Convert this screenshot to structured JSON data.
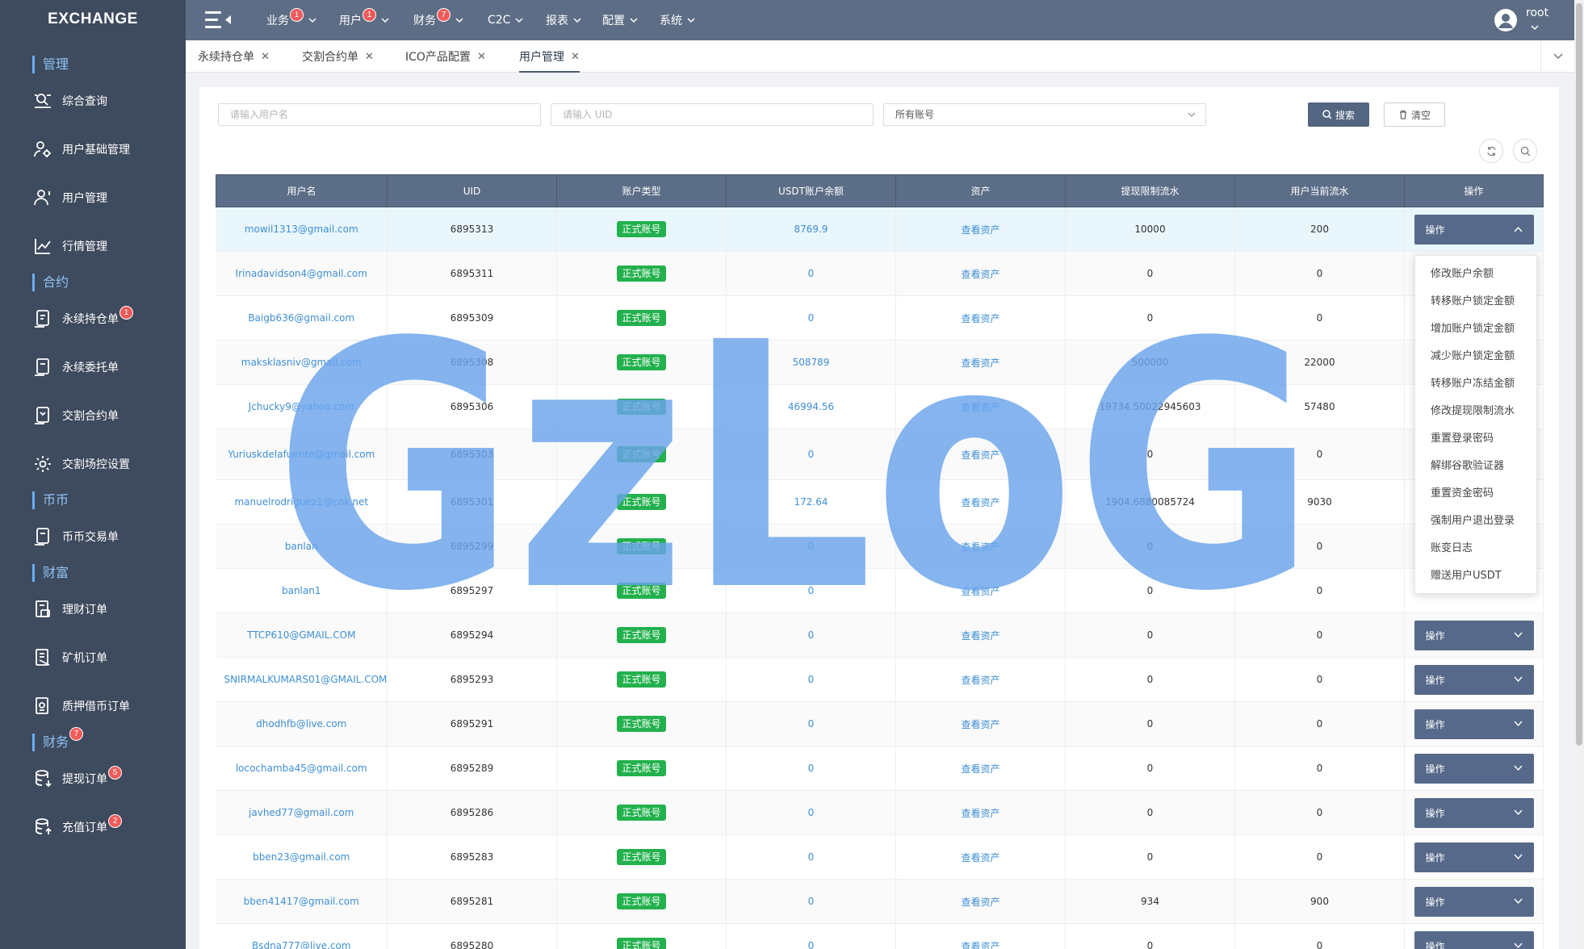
{
  "app": {
    "logo": "EXCHANGE"
  },
  "sidebar": {
    "sections": [
      {
        "label": "管理"
      },
      {
        "label": "合约"
      },
      {
        "label": "币币"
      },
      {
        "label": "财富"
      },
      {
        "label": "财务",
        "badge": "7"
      }
    ],
    "items": [
      {
        "label": "综合查询",
        "icon": "search-list-icon"
      },
      {
        "label": "用户基础管理",
        "icon": "user-gear-icon"
      },
      {
        "label": "用户管理",
        "icon": "user-icon"
      },
      {
        "label": "行情管理",
        "icon": "chart-line-icon"
      },
      {
        "label": "永续持仓单",
        "icon": "document-icon",
        "badge": "1"
      },
      {
        "label": "永续委托单",
        "icon": "document-icon"
      },
      {
        "label": "交割合约单",
        "icon": "document-icon"
      },
      {
        "label": "交割场控设置",
        "icon": "gear-icon"
      },
      {
        "label": "币币交易单",
        "icon": "document-icon"
      },
      {
        "label": "理财订单",
        "icon": "order-icon"
      },
      {
        "label": "矿机订单",
        "icon": "order-icon"
      },
      {
        "label": "质押借币订单",
        "icon": "order-icon"
      },
      {
        "label": "提现订单",
        "icon": "database-icon",
        "badge": "5"
      },
      {
        "label": "充值订单",
        "icon": "database-icon",
        "badge": "2"
      }
    ]
  },
  "topbar": {
    "nav": [
      {
        "label": "业务",
        "badge": "1"
      },
      {
        "label": "用户",
        "badge": "1"
      },
      {
        "label": "财务",
        "badge": "7"
      },
      {
        "label": "C2C"
      },
      {
        "label": "报表"
      },
      {
        "label": "配置"
      },
      {
        "label": "系统"
      }
    ],
    "user": "root"
  },
  "tabs": [
    {
      "label": "永续持仓单",
      "active": false
    },
    {
      "label": "交割合约单",
      "active": false
    },
    {
      "label": "ICO产品配置",
      "active": false
    },
    {
      "label": "用户管理",
      "active": true
    }
  ],
  "filters": {
    "username_placeholder": "请输入用户名",
    "uid_placeholder": "请输入 UID",
    "account_select": "所有账号",
    "search_label": "搜索",
    "clear_label": "清空"
  },
  "table": {
    "columns": [
      "用户名",
      "UID",
      "账户类型",
      "USDT账户余额",
      "资产",
      "提现限制流水",
      "用户当前流水",
      "操作"
    ],
    "view_assets_label": "查看资产",
    "op_label": "操作",
    "rows": [
      {
        "username": "mowil1313@gmail.com",
        "uid": "6895313",
        "type": "正式账号",
        "usdt": "8769.9",
        "withdraw_limit": "10000",
        "current_flow": "200"
      },
      {
        "username": "Irinadavidson4@gmail.com",
        "uid": "6895311",
        "type": "正式账号",
        "usdt": "0",
        "withdraw_limit": "0",
        "current_flow": "0"
      },
      {
        "username": "Baigb636@gmail.com",
        "uid": "6895309",
        "type": "正式账号",
        "usdt": "0",
        "withdraw_limit": "0",
        "current_flow": "0"
      },
      {
        "username": "maksklasniv@gmail.com",
        "uid": "6895308",
        "type": "正式账号",
        "usdt": "508789",
        "withdraw_limit": "500000",
        "current_flow": "22000"
      },
      {
        "username": "Jchucky9@yahoo.com",
        "uid": "6895306",
        "type": "正式账号",
        "usdt": "46994.56",
        "withdraw_limit": "19734.50022945603",
        "current_flow": "57480"
      },
      {
        "username": "Yuriuskdelafuente@gmail.com",
        "uid": "6895303",
        "type": "正式账号",
        "usdt": "0",
        "withdraw_limit": "0",
        "current_flow": "0"
      },
      {
        "username": "manuelrodriguez1@cox.net",
        "uid": "6895301",
        "type": "正式账号",
        "usdt": "172.64",
        "withdraw_limit": "1904.6880085724",
        "current_flow": "9030"
      },
      {
        "username": "banlan",
        "uid": "6895299",
        "type": "正式账号",
        "usdt": "0",
        "withdraw_limit": "0",
        "current_flow": "0"
      },
      {
        "username": "banlan1",
        "uid": "6895297",
        "type": "正式账号",
        "usdt": "0",
        "withdraw_limit": "0",
        "current_flow": "0"
      },
      {
        "username": "TTCP610@GMAIL.COM",
        "uid": "6895294",
        "type": "正式账号",
        "usdt": "0",
        "withdraw_limit": "0",
        "current_flow": "0"
      },
      {
        "username": "SNIRMALKUMARS01@GMAIL.COM",
        "uid": "6895293",
        "type": "正式账号",
        "usdt": "0",
        "withdraw_limit": "0",
        "current_flow": "0"
      },
      {
        "username": "dhodhfb@live.com",
        "uid": "6895291",
        "type": "正式账号",
        "usdt": "0",
        "withdraw_limit": "0",
        "current_flow": "0"
      },
      {
        "username": "locochamba45@gmail.com",
        "uid": "6895289",
        "type": "正式账号",
        "usdt": "0",
        "withdraw_limit": "0",
        "current_flow": "0"
      },
      {
        "username": "javhed77@gmail.com",
        "uid": "6895286",
        "type": "正式账号",
        "usdt": "0",
        "withdraw_limit": "0",
        "current_flow": "0"
      },
      {
        "username": "bben23@gmail.com",
        "uid": "6895283",
        "type": "正式账号",
        "usdt": "0",
        "withdraw_limit": "0",
        "current_flow": "0"
      },
      {
        "username": "bben41417@gmail.com",
        "uid": "6895281",
        "type": "正式账号",
        "usdt": "0",
        "withdraw_limit": "934",
        "current_flow": "900"
      },
      {
        "username": "Bsdna777@live.com",
        "uid": "6895280",
        "type": "正式账号",
        "usdt": "0",
        "withdraw_limit": "0",
        "current_flow": "0"
      }
    ]
  },
  "op_dropdown": [
    "修改账户余额",
    "转移账户锁定金额",
    "增加账户锁定金额",
    "减少账户锁定金额",
    "转移账户冻结金额",
    "修改提现限制流水",
    "重置登录密码",
    "解绑谷歌验证器",
    "重置资金密码",
    "强制用户退出登录",
    "账变日志",
    "赠送用户USDT"
  ],
  "watermark": "GzLoG",
  "colors": {
    "sidebar": "#3e4a5d",
    "topbar": "#5d6d85",
    "table_header": "#5b6d87",
    "link": "#3f8fd3",
    "badge_green": "#23b14d",
    "badge_red": "#ef5a5a",
    "watermark": "#6aa4ec"
  }
}
